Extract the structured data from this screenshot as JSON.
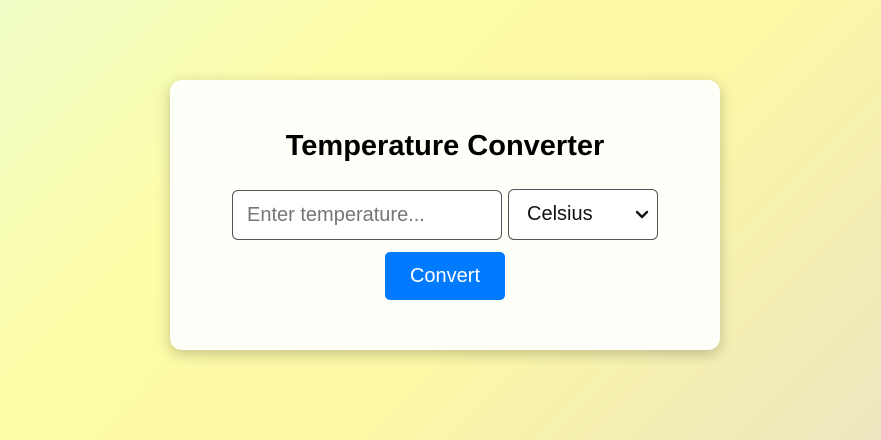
{
  "converter": {
    "title": "Temperature Converter",
    "input_value": "",
    "input_placeholder": "Enter temperature...",
    "unit_selected": "Celsius",
    "convert_label": "Convert"
  },
  "colors": {
    "accent": "#007bff",
    "card_background": "#fefff8"
  },
  "icons": {
    "select_arrow": "chevron-down-icon"
  }
}
